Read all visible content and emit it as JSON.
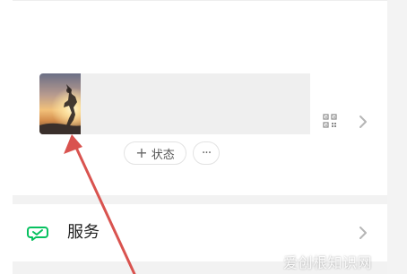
{
  "profile": {
    "status_label": "状态",
    "more_label": "···"
  },
  "services": {
    "label": "服务"
  },
  "watermark": {
    "text": "爱创根知识网"
  },
  "colors": {
    "background": "#f2f2f2",
    "card": "#ffffff",
    "mask": "#efefef",
    "arrow": "#d9534f",
    "services_icon": "#07c160"
  },
  "icons": {
    "qr": "qr-code-icon",
    "chevron": "chevron-right-icon",
    "plus": "plus-icon",
    "services": "services-icon"
  }
}
